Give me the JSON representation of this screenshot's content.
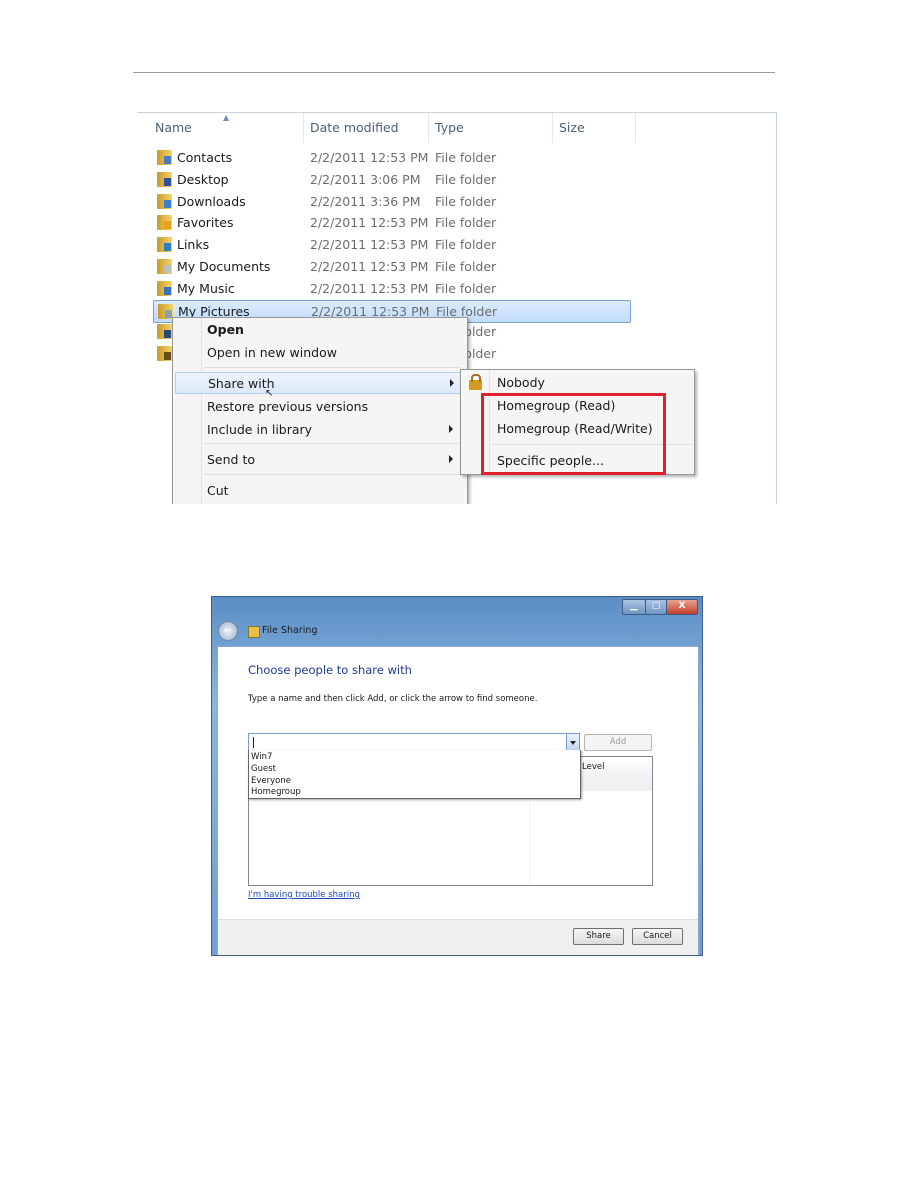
{
  "explorer": {
    "columns": [
      "Name",
      "Date modified",
      "Type",
      "Size"
    ],
    "rows": [
      {
        "name": "Contacts",
        "date": "2/2/2011 12:53 PM",
        "type": "File folder"
      },
      {
        "name": "Desktop",
        "date": "2/2/2011 3:06 PM",
        "type": "File folder"
      },
      {
        "name": "Downloads",
        "date": "2/2/2011 3:36 PM",
        "type": "File folder"
      },
      {
        "name": "Favorites",
        "date": "2/2/2011 12:53 PM",
        "type": "File folder"
      },
      {
        "name": "Links",
        "date": "2/2/2011 12:53 PM",
        "type": "File folder"
      },
      {
        "name": "My Documents",
        "date": "2/2/2011 12:53 PM",
        "type": "File folder"
      },
      {
        "name": "My Music",
        "date": "2/2/2011 12:53 PM",
        "type": "File folder"
      },
      {
        "name": "My Pictures",
        "date": "2/2/2011 12:53 PM",
        "type": "File folder",
        "selected": true
      },
      {
        "name": "",
        "date": "",
        "type": "File folder"
      },
      {
        "name": "",
        "date": "",
        "type": "File folder"
      }
    ],
    "context_menu": {
      "open": "Open",
      "open_new_window": "Open in new window",
      "share_with": "Share with",
      "restore": "Restore previous versions",
      "include_library": "Include in library",
      "send_to": "Send to",
      "cut": "Cut"
    },
    "share_submenu": {
      "nobody": "Nobody",
      "homegroup_read": "Homegroup (Read)",
      "homegroup_readwrite": "Homegroup (Read/Write)",
      "specific_people": "Specific people..."
    },
    "highlight_color": "#e0202a"
  },
  "dialog": {
    "title": "File Sharing",
    "window_buttons": {
      "minimize": "▁",
      "maximize": "▢",
      "close": "X"
    },
    "heading": "Choose people to share with",
    "instruction": "Type a name and then click Add, or click the arrow to find someone.",
    "name_input_value": "",
    "add_label": "Add",
    "dropdown_options": [
      "Win7",
      "Guest",
      "Everyone",
      "Homegroup"
    ],
    "level_header": "Level",
    "trouble_link": "I'm having trouble sharing",
    "share_label": "Share",
    "cancel_label": "Cancel"
  }
}
